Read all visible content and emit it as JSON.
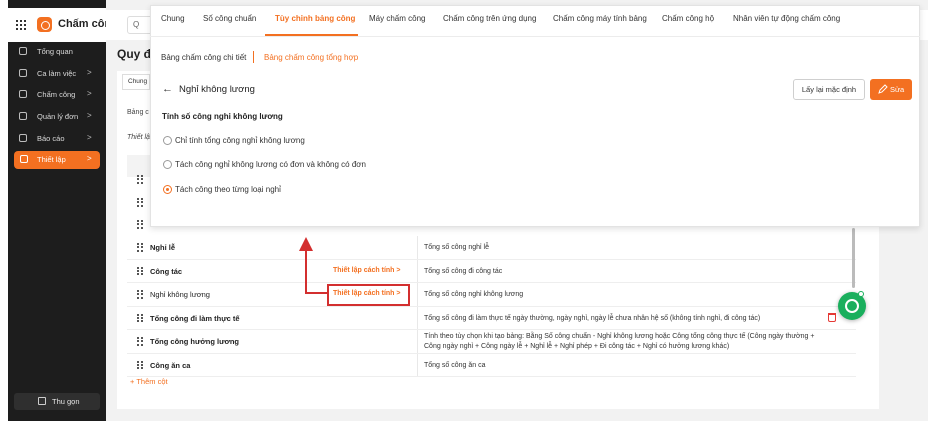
{
  "app": {
    "name": "Chấm công"
  },
  "sidebar": {
    "items": [
      {
        "label": "Tổng quan",
        "icon": "home-icon",
        "chevron": ""
      },
      {
        "label": "Ca làm việc",
        "icon": "calendar-icon",
        "chevron": ">"
      },
      {
        "label": "Chấm công",
        "icon": "list-icon",
        "chevron": ">"
      },
      {
        "label": "Quản lý đơn",
        "icon": "document-icon",
        "chevron": ">"
      },
      {
        "label": "Báo cáo",
        "icon": "chart-icon",
        "chevron": ">"
      },
      {
        "label": "Thiết lập",
        "icon": "gear-icon",
        "chevron": ">",
        "active": true
      }
    ],
    "collapse_label": "Thu gọn"
  },
  "background": {
    "search_icon": "Q",
    "page_title": "Quy đị",
    "tab_label": "Chung",
    "row1": "Bảng c",
    "row2": "Thiết lậ"
  },
  "tabs": [
    {
      "label": "Chung"
    },
    {
      "label": "Số công chuẩn"
    },
    {
      "label": "Tùy chỉnh bảng công",
      "active": true
    },
    {
      "label": "Máy chấm công"
    },
    {
      "label": "Chấm công trên ứng dụng"
    },
    {
      "label": "Chấm công máy tính bảng"
    },
    {
      "label": "Chấm công hộ"
    },
    {
      "label": "Nhân viên tự động chấm công"
    }
  ],
  "subtabs": [
    {
      "label": "Bảng chấm công chi tiết"
    },
    {
      "label": "Bảng chấm công tổng hợp",
      "active": true
    }
  ],
  "header": {
    "back": "←",
    "title": "Nghỉ không lương",
    "reset_button": "Lấy lại mặc định",
    "edit_button": "Sửa"
  },
  "settings": {
    "section_title": "Tính số công nghỉ không lương",
    "options": [
      {
        "label": "Chỉ tính tổng công nghỉ không lương",
        "checked": false
      },
      {
        "label": "Tách công nghỉ không lương có đơn và không có đơn",
        "checked": false
      },
      {
        "label": "Tách công theo từng loại nghỉ",
        "checked": true
      }
    ]
  },
  "table": {
    "rows": [
      {
        "name": "Nghỉ lễ",
        "link": "",
        "desc": "Tổng số công nghỉ lễ"
      },
      {
        "name": "Công tác",
        "link": "Thiết lập cách tính >",
        "desc": "Tổng số công đi công tác"
      },
      {
        "name": "Nghỉ không lương",
        "link": "Thiết lập cách tính >",
        "desc": "Tổng số công nghỉ không lương"
      },
      {
        "name": "Tổng công đi làm thực tế",
        "link": "",
        "desc": "Tổng số công đi làm thực tế ngày thường, ngày nghỉ, ngày lễ chưa nhân hệ số (không tính nghỉ, đi công tác)"
      },
      {
        "name": "Tổng công hưởng lương",
        "link": "",
        "desc": "Tính theo tùy chọn khi tạo bảng: Bằng Số công chuẩn - Nghỉ không lương hoặc Công tổng công thực tế (Công ngày thường + Công ngày nghỉ + Công ngày lễ + Nghỉ lễ + Nghỉ phép + Đi công tác + Nghỉ có hưởng lương khác)"
      },
      {
        "name": "Công ăn ca",
        "link": "",
        "desc": "Tổng số công ăn ca"
      }
    ],
    "add_column": "+ Thêm cột"
  },
  "colors": {
    "accent": "#f37021",
    "sidebar": "#1d1d1d",
    "highlight": "#d32f2f",
    "fab": "#1aaf5d"
  }
}
